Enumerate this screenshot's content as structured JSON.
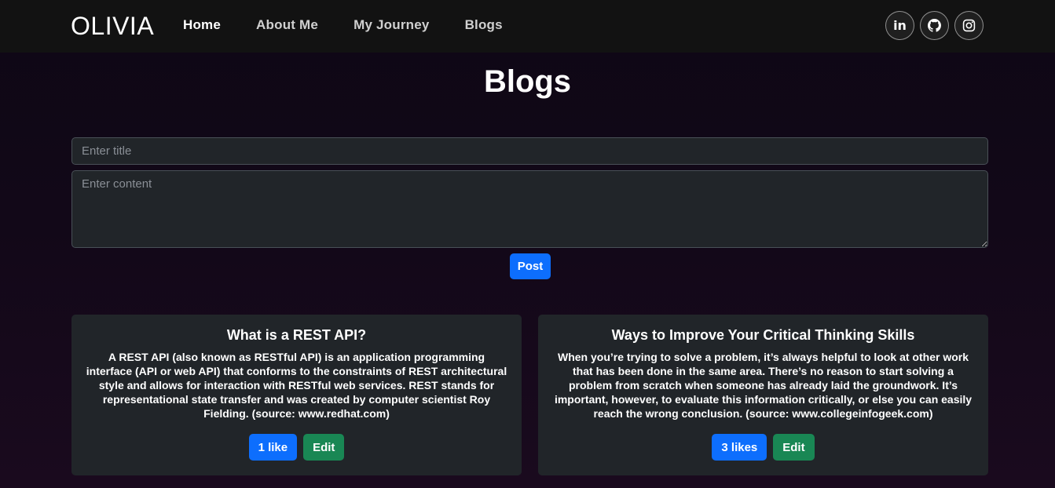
{
  "nav": {
    "brand": "OLIVIA",
    "links": [
      {
        "label": "Home"
      },
      {
        "label": "About Me"
      },
      {
        "label": "My Journey"
      },
      {
        "label": "Blogs"
      }
    ],
    "social": [
      {
        "icon": "linkedin-icon",
        "label": "in"
      },
      {
        "icon": "github-icon"
      },
      {
        "icon": "instagram-icon"
      }
    ]
  },
  "page": {
    "title": "Blogs"
  },
  "form": {
    "title_placeholder": "Enter title",
    "content_placeholder": "Enter content",
    "post_label": "Post"
  },
  "posts": [
    {
      "title": "What is a REST API?",
      "content": "A REST API (also known as RESTful API) is an application programming interface (API or web API) that conforms to the constraints of REST architectural style and allows for interaction with RESTful web services. REST stands for representational state transfer and was created by computer scientist Roy Fielding. (source: www.redhat.com)",
      "likes_label": "1 like",
      "edit_label": "Edit"
    },
    {
      "title": "Ways to Improve Your Critical Thinking Skills",
      "content": "When you’re trying to solve a problem, it’s always helpful to look at other work that has been done in the same area. There’s no reason to start solving a problem from scratch when someone has already laid the groundwork. It’s important, however, to evaluate this information critically, or else you can easily reach the wrong conclusion. (source: www.collegeinfogeek.com)",
      "likes_label": "3 likes",
      "edit_label": "Edit"
    }
  ],
  "colors": {
    "primary": "#0d6efd",
    "success": "#198754",
    "navbar": "#121212",
    "card": "#212529"
  }
}
